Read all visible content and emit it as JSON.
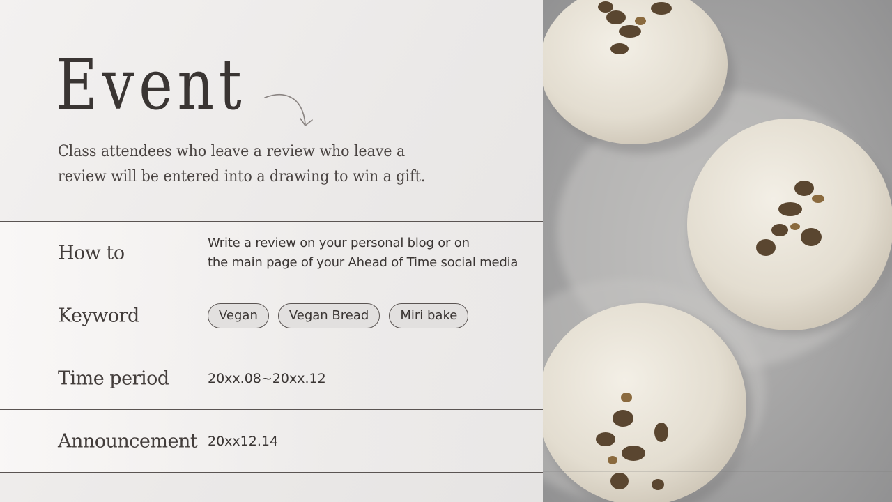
{
  "header": {
    "title": "Event",
    "intro_line1": "Class attendees who leave a review who leave a",
    "intro_line2": "review will be entered into a drawing to win a gift."
  },
  "rows": [
    {
      "label": "How to",
      "value_line1": "Write a review on your personal blog or on",
      "value_line2": "the main page of your Ahead of Time social media"
    },
    {
      "label": "Keyword",
      "chips": [
        "Vegan",
        "Vegan Bread",
        "Miri bake"
      ]
    },
    {
      "label": "Time period",
      "value": "20xx.08~20xx.12"
    },
    {
      "label": "Announcement",
      "value": "20xx12.14"
    }
  ],
  "photo": {
    "icon": "bread-dough-balls-photo"
  },
  "colors": {
    "text": "#3a3533",
    "rule": "#5a5452",
    "chip_bg": "#e2e0df"
  }
}
